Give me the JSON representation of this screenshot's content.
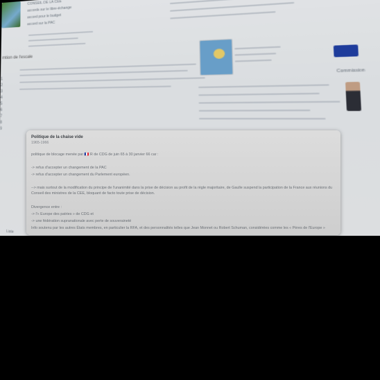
{
  "background_page": {
    "sidebar_lines": [
      "CONSEIL DE LA CEE",
      "accords sur le libre-échange",
      "accord pour le budget",
      "accord sur la PAC"
    ],
    "left_heading": "mtion de l'escale",
    "left_list": [
      "1",
      "2",
      "3",
      "4",
      "5",
      "6",
      "7",
      "8",
      "9"
    ],
    "caption_label": "Commission",
    "bottom_label": "Liste"
  },
  "note": {
    "title": "Politique de la chaise vide",
    "date": "1965-1966",
    "lines": [
      "politique de blocage menée par 🇫🇷 R de CDG de juin 65 à 30 janvier 66 car :",
      "-> refus d'accepter un changement de la PAC",
      "-> refus d'accepter un changement du Parlement européen.",
      "--> mais surtout de la modification du principe de l'unanimité dans la prise de décision au profit de la règle majoritaire, de Gaulle suspend la participation de la France aux réunions du Conseil des ministres de la CEE, bloquant de facto toute prise de décision.",
      "Divergence entre :",
      "-> l'« Europe des patries » de CDG et",
      "-> une fédération supranationale avec perte de souveraineté",
      "Info soutenu par les autres États membres, en particulier la RFA, et des personnalités telles que Jean Monnet ou Robert Schuman, considérées comme les « Pères de l'Europe »"
    ]
  },
  "colors": {
    "overlay_bg": "#d6d6d6",
    "title_color": "#3b3f44",
    "body_color": "#6a6f75",
    "backdrop": "#000000"
  }
}
